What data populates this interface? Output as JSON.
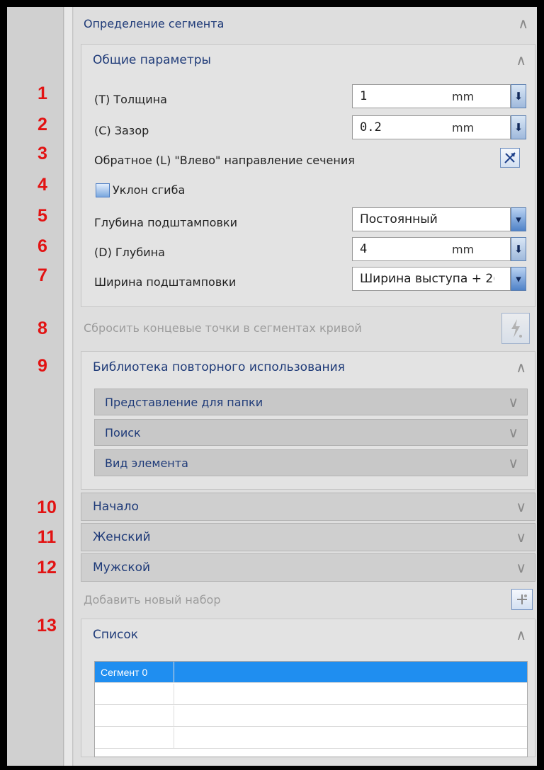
{
  "panel": {
    "title": "Определение сегмента"
  },
  "markers": [
    "1",
    "2",
    "3",
    "4",
    "5",
    "6",
    "7",
    "8",
    "9",
    "10",
    "11",
    "12",
    "13"
  ],
  "general": {
    "header": "Общие параметры",
    "thickness": {
      "label": "(T) Толщина",
      "value": "1",
      "unit": "mm"
    },
    "gap": {
      "label": "(C) Зазор",
      "value": "0.2",
      "unit": "mm"
    },
    "reverse": {
      "label": "Обратное (L) \"Влево\" направление сечения"
    },
    "bend_relief": {
      "label": "Уклон сгиба",
      "checked": false
    },
    "emboss_depth": {
      "label": "Глубина подштамповки",
      "value": "Постоянный"
    },
    "depth": {
      "label": "(D) Глубина",
      "value": "4",
      "unit": "mm"
    },
    "emboss_width": {
      "label": "Ширина подштамповки",
      "value": "Ширина выступа + 2("
    }
  },
  "reset_endpoints": {
    "label": "Сбросить концевые точки в сегментах кривой"
  },
  "reuse_library": {
    "header": "Библиотека повторного использования",
    "sections": [
      "Представление для папки",
      "Поиск",
      "Вид элемента"
    ]
  },
  "sections": {
    "start": "Начало",
    "female": "Женский",
    "male": "Мужской"
  },
  "add_set": {
    "label": "Добавить новый набор"
  },
  "list": {
    "header": "Список",
    "rows": [
      "Сегмент 0",
      "",
      "",
      ""
    ]
  },
  "colors": {
    "marker": "#e21313",
    "accent": "#1e3a78",
    "selection": "#1f8ef0"
  }
}
